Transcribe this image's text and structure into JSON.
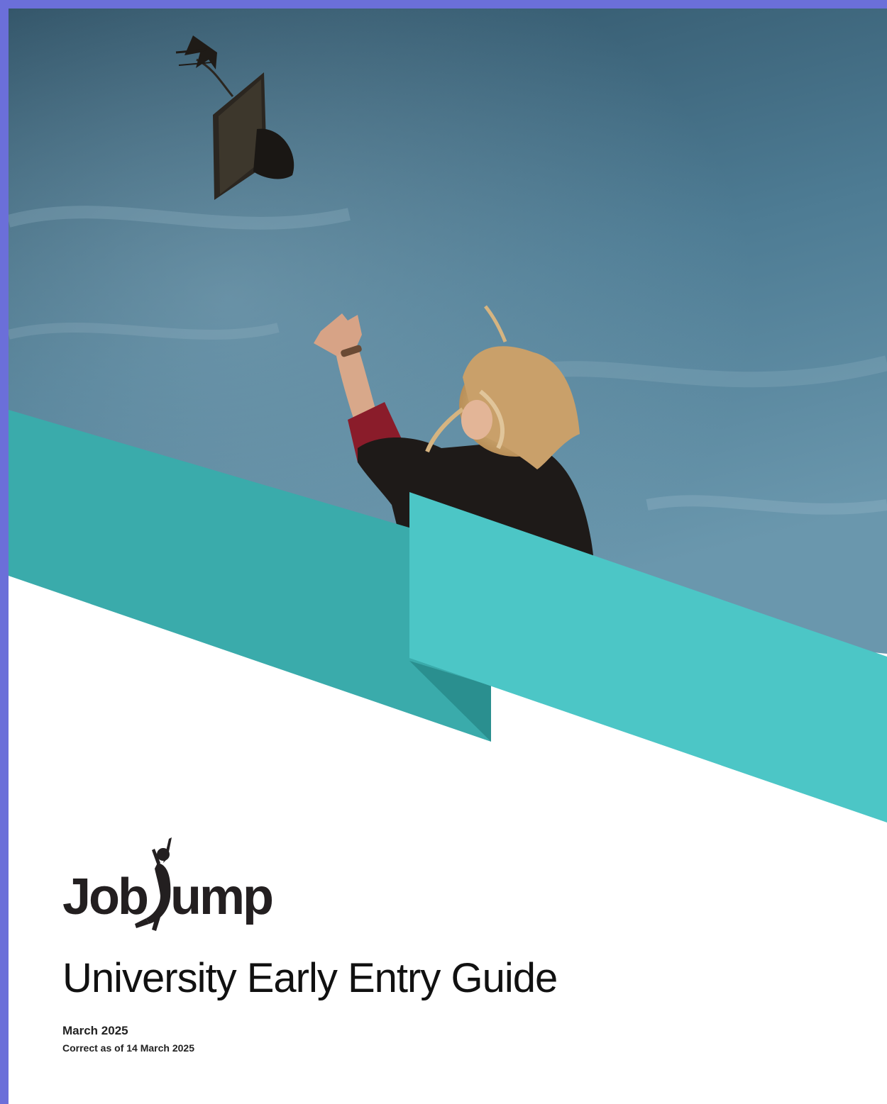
{
  "brand": {
    "logo_left": "Job",
    "logo_right": "ump",
    "colors": {
      "teal_light": "#4cc6c6",
      "teal_dark": "#3aabab",
      "teal_fold": "#2a8f8f",
      "sky_top": "#33566a",
      "sky_bottom": "#5f8ea6",
      "frame": "#6b6fd9"
    }
  },
  "cover": {
    "image_subject": "graduate tossing mortarboard cap into blue sky",
    "title": "University Early Entry Guide",
    "date": "March 2025",
    "correct_as_of": "Correct as of 14 March 2025"
  }
}
